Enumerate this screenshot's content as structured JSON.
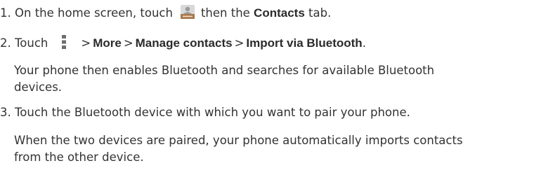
{
  "steps": [
    {
      "number": "1.",
      "text_before_icon": "On the home screen, touch",
      "icon": "contacts-app-icon",
      "text_after_icon": "then the",
      "bold": "Contacts",
      "text_end": "tab."
    },
    {
      "number": "2.",
      "text_before_icon": "Touch",
      "icon": "menu-overflow-icon",
      "path": [
        "More",
        "Manage contacts",
        "Import via Bluetooth"
      ],
      "separator": ">",
      "end": ".",
      "note_lines": [
        "Your phone then enables Bluetooth and searches for available Bluetooth",
        "devices."
      ]
    },
    {
      "number": "3.",
      "text": "Touch the Bluetooth device with which you want to pair your phone.",
      "note_lines": [
        "When the two devices are paired, your phone automatically imports contacts",
        "from the other device."
      ]
    }
  ],
  "colors": {
    "text": "#333333",
    "bold": "#2b2b2b",
    "icon_brown": "#a8774a",
    "icon_gray": "#6e6e6e"
  }
}
